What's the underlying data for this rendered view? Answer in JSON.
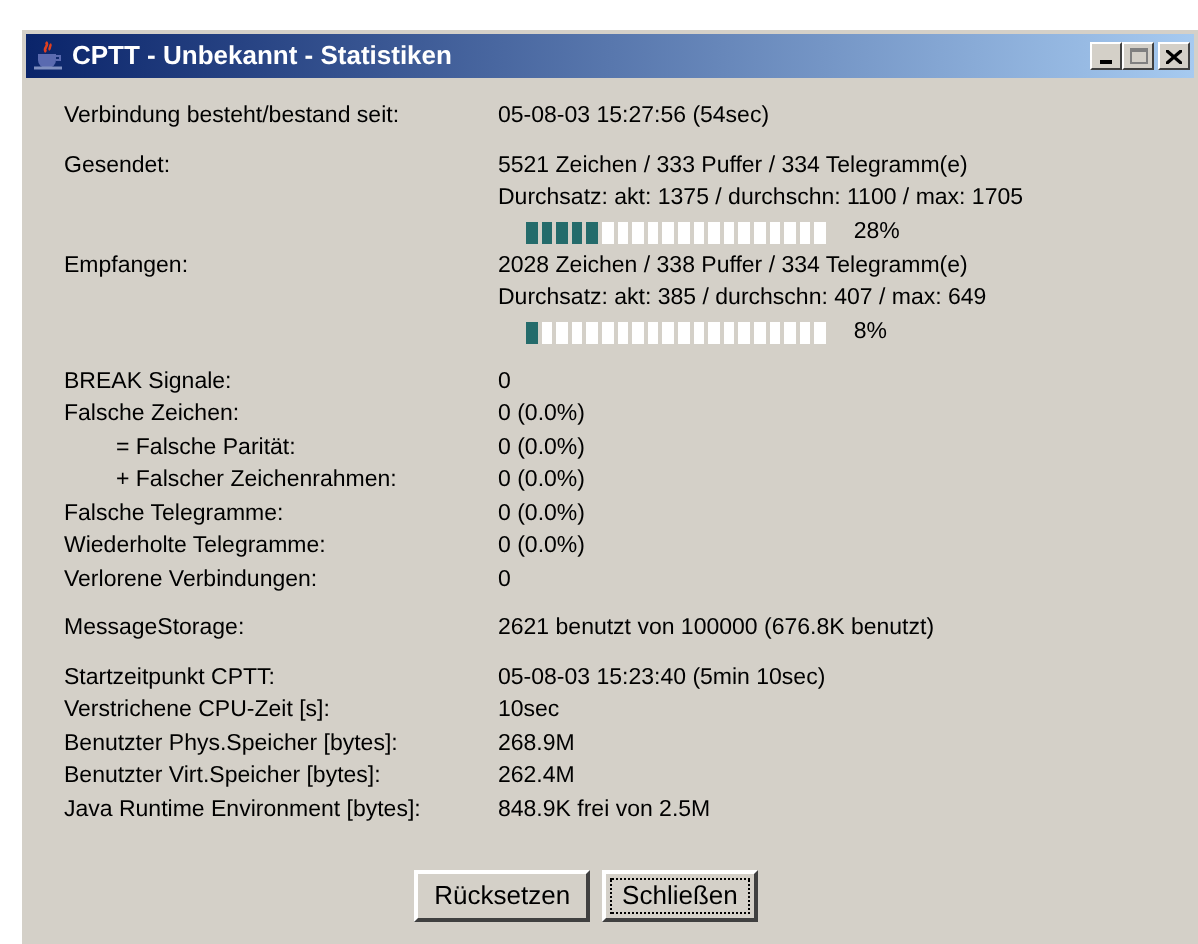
{
  "window": {
    "title": "CPTT - Unbekannt - Statistiken"
  },
  "groups": [
    [
      {
        "label": "Verbindung besteht/bestand seit:",
        "lines": [
          "05-08-03 15:27:56 (54sec)"
        ]
      }
    ],
    [
      {
        "label": "Gesendet:",
        "lines": [
          "5521 Zeichen / 333 Puffer / 334 Telegramm(e)",
          "Durchsatz: akt: 1375 / durchschn: 1100 / max: 1705"
        ],
        "meter": {
          "level": 0.28,
          "reading": "28%"
        }
      },
      {
        "label": "Empfangen:",
        "lines": [
          "2028 Zeichen / 338 Puffer / 334 Telegramm(e)",
          "Durchsatz: akt: 385 / durchschn: 407 / max: 649"
        ],
        "meter": {
          "level": 0.08,
          "reading": "8%"
        }
      }
    ],
    [
      {
        "label": "BREAK Signale:",
        "lines": [
          "0"
        ]
      },
      {
        "label": "Falsche Zeichen:",
        "lines": [
          "0 (0.0%)"
        ],
        "children": [
          {
            "label": "= Falsche Parität:",
            "lines": [
              "0 (0.0%)"
            ]
          },
          {
            "label": "+ Falscher Zeichenrahmen:",
            "lines": [
              "0 (0.0%)"
            ]
          }
        ]
      },
      {
        "label": "Falsche Telegramme:",
        "lines": [
          "0 (0.0%)"
        ]
      },
      {
        "label": "Wiederholte Telegramme:",
        "lines": [
          "0 (0.0%)"
        ]
      },
      {
        "label": "Verlorene Verbindungen:",
        "lines": [
          "0"
        ]
      }
    ],
    [
      {
        "label": "MessageStorage:",
        "lines": [
          "2621 benutzt von 100000 (676.8K benutzt)"
        ]
      }
    ],
    [
      {
        "label": "Startzeitpunkt CPTT:",
        "lines": [
          "05-08-03 15:23:40 (5min 10sec)"
        ]
      },
      {
        "label": "Verstrichene CPU-Zeit [s]:",
        "lines": [
          "10sec"
        ]
      },
      {
        "label": "Benutzter Phys.Speicher [bytes]:",
        "lines": [
          "268.9M"
        ]
      },
      {
        "label": "Benutzter Virt.Speicher [bytes]:",
        "lines": [
          "262.4M"
        ]
      },
      {
        "label": "Java Runtime Environment [bytes]:",
        "lines": [
          "848.9K frei von 2.5M"
        ]
      }
    ]
  ],
  "buttons": [
    {
      "label": "Rücksetzen",
      "focused": false
    },
    {
      "label": "Schließen",
      "focused": true
    }
  ]
}
